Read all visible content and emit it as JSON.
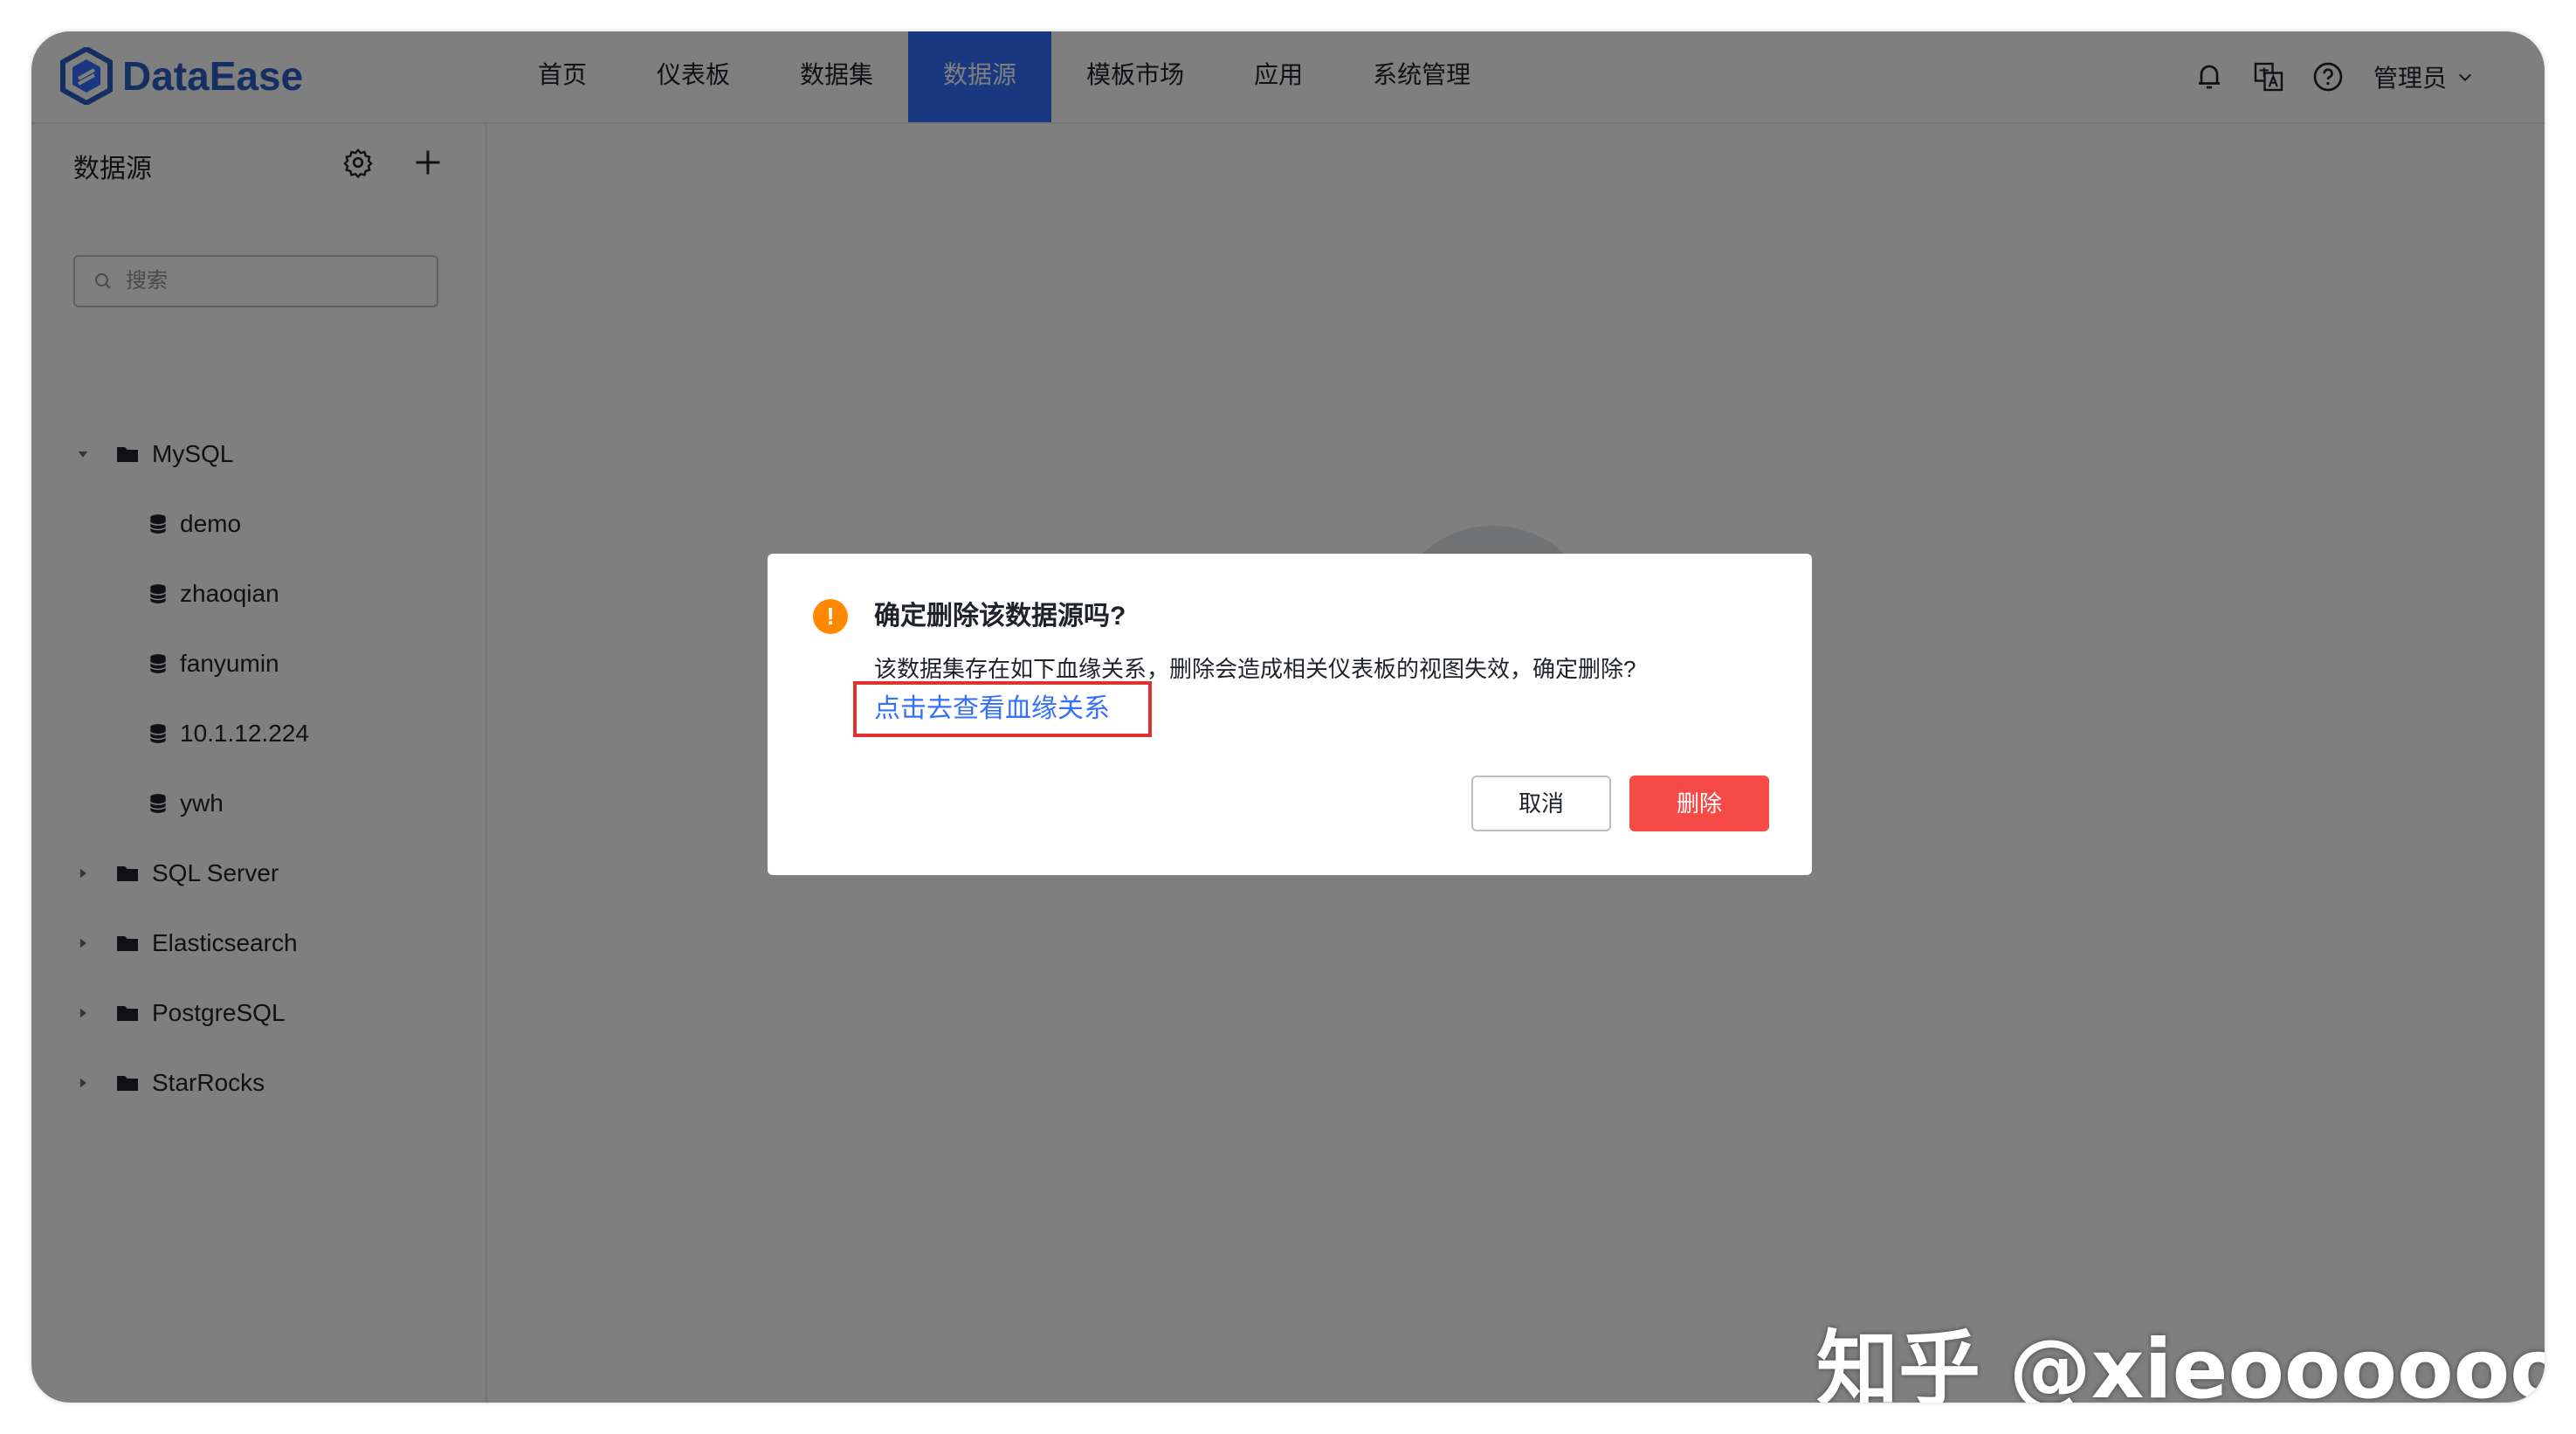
{
  "app": {
    "logo_text": "DataEase"
  },
  "nav": {
    "items": [
      {
        "label": "首页"
      },
      {
        "label": "仪表板"
      },
      {
        "label": "数据集"
      },
      {
        "label": "数据源"
      },
      {
        "label": "模板市场"
      },
      {
        "label": "应用"
      },
      {
        "label": "系统管理"
      }
    ],
    "active_index": 3
  },
  "header_right": {
    "icons": [
      "bell-icon",
      "translate-icon",
      "help-icon"
    ],
    "user": "管理员"
  },
  "sidebar": {
    "title": "数据源",
    "search_placeholder": "搜索",
    "tree": [
      {
        "type": "folder",
        "label": "MySQL",
        "expanded": true
      },
      {
        "type": "datasource",
        "label": "demo"
      },
      {
        "type": "datasource",
        "label": "zhaoqian"
      },
      {
        "type": "datasource",
        "label": "fanyumin"
      },
      {
        "type": "datasource",
        "label": "10.1.12.224"
      },
      {
        "type": "datasource",
        "label": "ywh"
      },
      {
        "type": "folder",
        "label": "SQL Server",
        "expanded": false
      },
      {
        "type": "folder",
        "label": "Elasticsearch",
        "expanded": false
      },
      {
        "type": "folder",
        "label": "PostgreSQL",
        "expanded": false
      },
      {
        "type": "folder",
        "label": "StarRocks",
        "expanded": false
      }
    ]
  },
  "dialog": {
    "title": "确定删除该数据源吗?",
    "message": "该数据集存在如下血缘关系，删除会造成相关仪表板的视图失效，确定删除?",
    "link": "点击去查看血缘关系",
    "cancel": "取消",
    "confirm": "删除"
  },
  "colors": {
    "primary": "#3370ff",
    "danger": "#f54a45",
    "warning": "#ff8800",
    "highlight_box": "#e0312f"
  },
  "watermark": "知乎 @xieoooooooo"
}
